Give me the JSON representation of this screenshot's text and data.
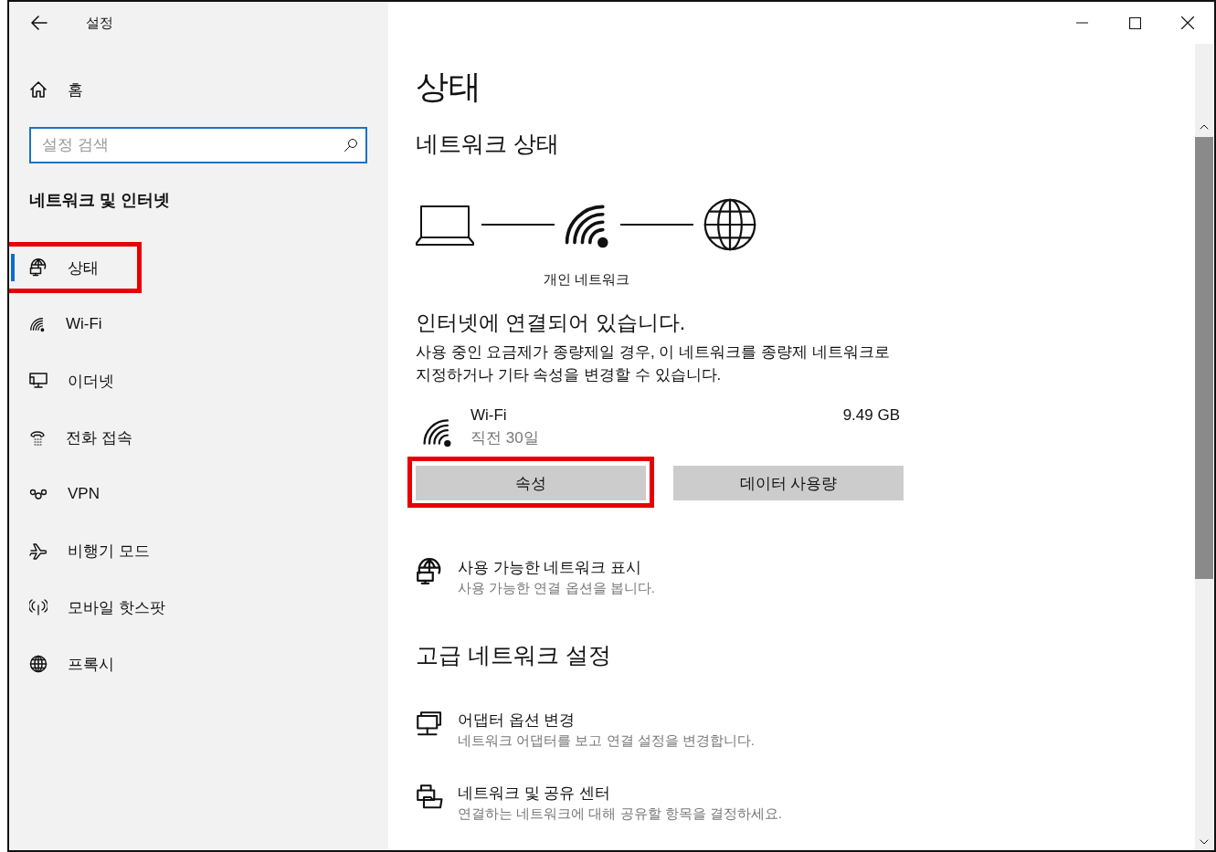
{
  "window": {
    "title": "설정"
  },
  "sidebar": {
    "home": "홈",
    "search": {
      "placeholder": "설정 검색"
    },
    "section": "네트워크 및 인터넷",
    "items": [
      {
        "label": "상태",
        "selected": true,
        "highlighted": true
      },
      {
        "label": "Wi-Fi",
        "selected": false,
        "highlighted": false
      },
      {
        "label": "이더넷",
        "selected": false,
        "highlighted": false
      },
      {
        "label": "전화 접속",
        "selected": false,
        "highlighted": false
      },
      {
        "label": "VPN",
        "selected": false,
        "highlighted": false
      },
      {
        "label": "비행기 모드",
        "selected": false,
        "highlighted": false
      },
      {
        "label": "모바일 핫스팟",
        "selected": false,
        "highlighted": false
      },
      {
        "label": "프록시",
        "selected": false,
        "highlighted": false
      }
    ]
  },
  "content": {
    "title": "상태",
    "network_status": {
      "heading": "네트워크 상태",
      "network_label": "개인 네트워크",
      "connection": "인터넷에 연결되어 있습니다.",
      "description": "사용 중인 요금제가 종량제일 경우, 이 네트워크를 종량제 네트워크로 지정하거나 기타 속성을 변경할 수 있습니다.",
      "adapter": {
        "name": "Wi-Fi",
        "period": "직전 30일",
        "usage": "9.49 GB"
      },
      "buttons": [
        {
          "label": "속성",
          "highlighted": true
        },
        {
          "label": "데이터 사용량",
          "highlighted": false
        }
      ]
    },
    "links": [
      {
        "title": "사용 가능한 네트워크 표시",
        "subtitle": "사용 가능한 연결 옵션을 봅니다."
      }
    ],
    "advanced": {
      "heading": "고급 네트워크 설정",
      "links": [
        {
          "title": "어댑터 옵션 변경",
          "subtitle": "네트워크 어댑터를 보고 연결 설정을 변경합니다."
        },
        {
          "title": "네트워크 및 공유 센터",
          "subtitle": "연결하는 네트워크에 대해 공유할 항목을 결정하세요."
        }
      ]
    }
  }
}
